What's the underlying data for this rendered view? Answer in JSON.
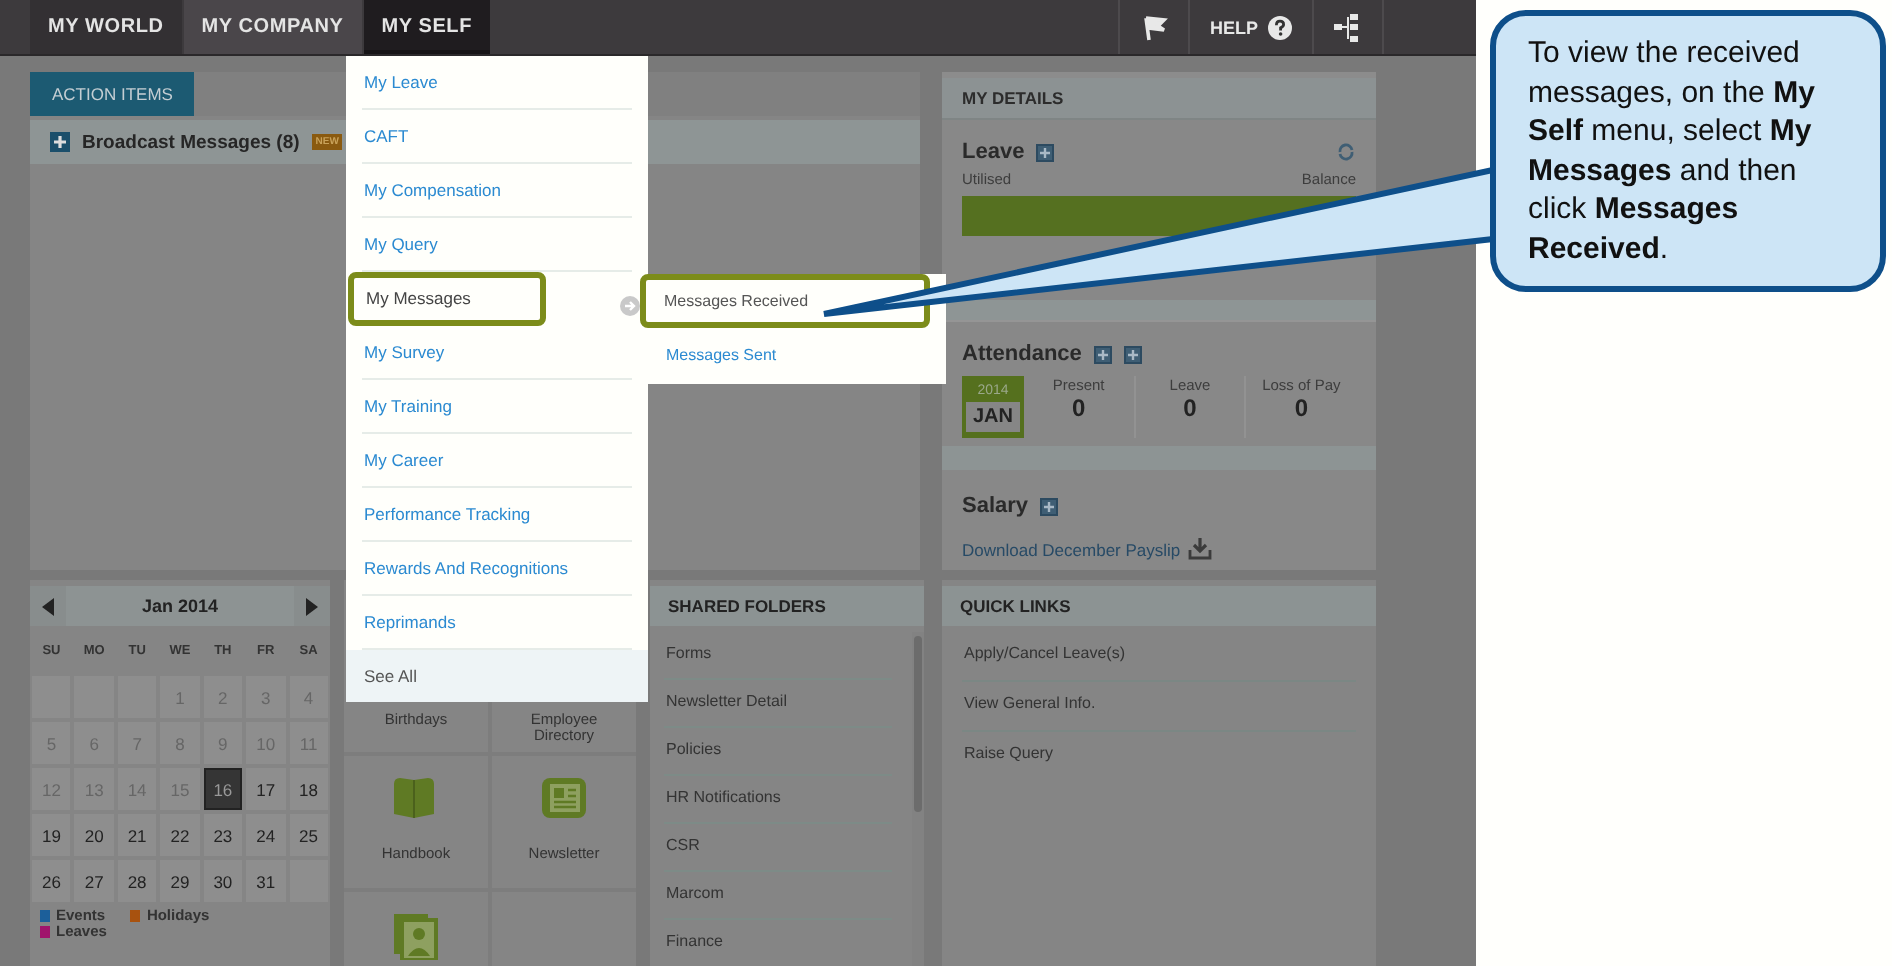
{
  "nav": {
    "tabs": [
      {
        "label": "MY WORLD",
        "selected": false,
        "current": true
      },
      {
        "label": "MY COMPANY",
        "selected": false,
        "current": false
      },
      {
        "label": "MY SELF",
        "selected": true,
        "current": false
      }
    ],
    "help": "HELP"
  },
  "action_items": {
    "tab": "ACTION ITEMS",
    "rows": [
      {
        "label": "Broadcast Messages (8)",
        "badge": "NEW"
      }
    ]
  },
  "my_details": {
    "title": "MY DETAILS",
    "leave": {
      "title": "Leave",
      "utilised_label": "Utilised",
      "balance_label": "Balance",
      "level": 1
    },
    "attendance": {
      "title": "Attendance",
      "year": "2014",
      "month": "JAN",
      "stats": [
        {
          "label": "Present",
          "value": "0"
        },
        {
          "label": "Leave",
          "value": "0"
        },
        {
          "label": "Loss of Pay",
          "value": "0"
        }
      ]
    },
    "salary": {
      "title": "Salary",
      "link": "Download December Payslip"
    }
  },
  "calendar": {
    "title": "Jan 2014",
    "weekdays": [
      "SU",
      "MO",
      "TU",
      "WE",
      "TH",
      "FR",
      "SA"
    ],
    "weeks": [
      [
        {
          "kind": "blank"
        },
        {
          "kind": "blank"
        },
        {
          "kind": "blank"
        },
        {
          "day": "1",
          "kind": "past"
        },
        {
          "day": "2",
          "kind": "past"
        },
        {
          "day": "3",
          "kind": "past"
        },
        {
          "day": "4",
          "kind": "past"
        }
      ],
      [
        {
          "day": "5",
          "kind": "past"
        },
        {
          "day": "6",
          "kind": "past"
        },
        {
          "day": "7",
          "kind": "past"
        },
        {
          "day": "8",
          "kind": "past"
        },
        {
          "day": "9",
          "kind": "past"
        },
        {
          "day": "10",
          "kind": "past"
        },
        {
          "day": "11",
          "kind": "past"
        }
      ],
      [
        {
          "day": "12",
          "kind": "past"
        },
        {
          "day": "13",
          "kind": "past"
        },
        {
          "day": "14",
          "kind": "past"
        },
        {
          "day": "15",
          "kind": "past"
        },
        {
          "day": "16",
          "kind": "today"
        },
        {
          "day": "17",
          "kind": "future"
        },
        {
          "day": "18",
          "kind": "future"
        }
      ],
      [
        {
          "day": "19",
          "kind": "future"
        },
        {
          "day": "20",
          "kind": "future"
        },
        {
          "day": "21",
          "kind": "future"
        },
        {
          "day": "22",
          "kind": "future"
        },
        {
          "day": "23",
          "kind": "future"
        },
        {
          "day": "24",
          "kind": "future"
        },
        {
          "day": "25",
          "kind": "future"
        }
      ],
      [
        {
          "day": "26",
          "kind": "future"
        },
        {
          "day": "27",
          "kind": "future"
        },
        {
          "day": "28",
          "kind": "future"
        },
        {
          "day": "29",
          "kind": "future"
        },
        {
          "day": "30",
          "kind": "future"
        },
        {
          "day": "31",
          "kind": "future"
        },
        {
          "kind": "blank"
        }
      ]
    ],
    "legend": [
      {
        "label": "Events",
        "color": "#1c5f9a"
      },
      {
        "label": "Leaves",
        "color": "#a0146c"
      },
      {
        "label": "Holidays",
        "color": "#a8520f"
      }
    ]
  },
  "tiles": [
    {
      "label": "Birthdays",
      "kind": "label_only"
    },
    {
      "label": "Employee Directory",
      "kind": "label_only"
    },
    {
      "label": "Handbook",
      "kind": "book"
    },
    {
      "label": "Newsletter",
      "kind": "newspaper"
    },
    {
      "kind": "portrait"
    },
    {
      "kind": "empty"
    }
  ],
  "shared_folders": {
    "title": "SHARED FOLDERS",
    "items": [
      "Forms",
      "Newsletter Detail",
      "Policies",
      "HR Notifications",
      "CSR",
      "Marcom",
      "Finance"
    ]
  },
  "quick_links": {
    "title": "QUICK LINKS",
    "items": [
      "Apply/Cancel Leave(s)",
      "View General Info.",
      "Raise Query"
    ]
  },
  "menu": {
    "items": [
      {
        "label": "My Leave",
        "kind": "link",
        "selected": false,
        "has_submenu": false
      },
      {
        "label": "CAFT",
        "kind": "link",
        "selected": false,
        "has_submenu": false
      },
      {
        "label": "My Compensation",
        "kind": "link",
        "selected": false,
        "has_submenu": false
      },
      {
        "label": "My Query",
        "kind": "link",
        "selected": false,
        "has_submenu": false
      },
      {
        "label": "My Messages",
        "kind": "link",
        "selected": true,
        "has_submenu": true
      },
      {
        "label": "My Survey",
        "kind": "link",
        "selected": false,
        "has_submenu": false
      },
      {
        "label": "My Training",
        "kind": "link",
        "selected": false,
        "has_submenu": false
      },
      {
        "label": "My Career",
        "kind": "link",
        "selected": false,
        "has_submenu": false
      },
      {
        "label": "Performance Tracking",
        "kind": "link",
        "selected": false,
        "has_submenu": false
      },
      {
        "label": "Rewards And Recognitions",
        "kind": "link",
        "selected": false,
        "has_submenu": false
      },
      {
        "label": "Reprimands",
        "kind": "link",
        "selected": false,
        "has_submenu": false
      },
      {
        "label": "See All",
        "kind": "see_all",
        "selected": false,
        "has_submenu": false
      }
    ]
  },
  "submenu": {
    "items": [
      {
        "label": "Messages Received",
        "selected": true
      },
      {
        "label": "Messages Sent",
        "selected": false
      }
    ]
  },
  "callout": {
    "text": "To view the received messages, on the **My Self** menu, select **My Messages** and then click **Messages Received**."
  }
}
